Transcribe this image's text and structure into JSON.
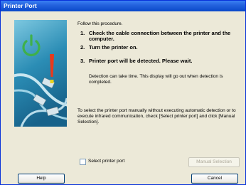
{
  "window": {
    "title": "Printer Port"
  },
  "body": {
    "intro": "Follow this procedure.",
    "steps": [
      {
        "num": "1.",
        "text": "Check the cable connection between the printer and the computer."
      },
      {
        "num": "2.",
        "text": "Turn the printer on."
      },
      {
        "num": "3.",
        "text": "Printer port will be detected. Please wait."
      }
    ],
    "note": "Detection can take time. This display will go out when detection is completed.",
    "manual_text": "To select the printer port manually without executing automatic detection or to execute infrared communication, check [Select printer port] and click [Manual Selection]."
  },
  "controls": {
    "select_port_label": "Select printer port",
    "select_port_checked": false,
    "manual_selection_label": "Manual Selection",
    "help_label": "Help",
    "cancel_label": "Cancel"
  },
  "colors": {
    "titlebar": "#2463de",
    "dialog_bg": "#ece9d8",
    "illustration_bg": "#1f7ea4",
    "power_icon": "#3fb04a",
    "warning_icon": "#e83a1c"
  }
}
